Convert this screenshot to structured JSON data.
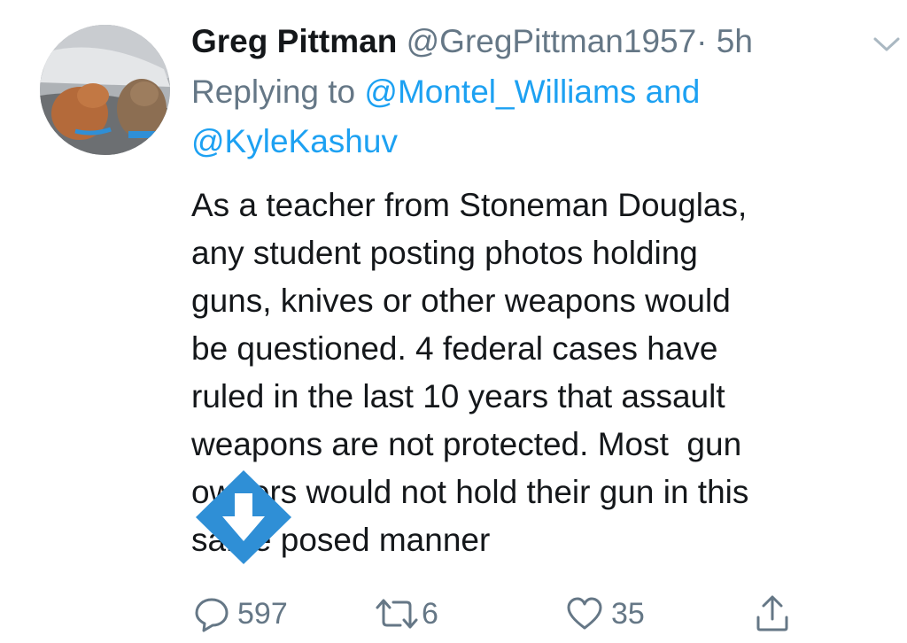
{
  "tweet": {
    "author_name": "Greg Pittman",
    "author_handle": "@GregPittman1957",
    "separator": "·",
    "time": "5h",
    "reply_prefix": "Replying to",
    "reply_user_1": "@Montel_Williams",
    "reply_and": "and",
    "reply_user_2": "@KyleKashuv",
    "body_lines": [
      "As a teacher from Stoneman Douglas,",
      "any student posting photos holding",
      "guns, knives or other weapons would",
      "be questioned. 4 federal cases have",
      "ruled in the last 10 years that assault",
      "weapons are not protected. Most  gun",
      "owners would not hold their gun in this",
      "same posed manner"
    ],
    "reply_count": "597",
    "retweet_count": "6",
    "like_count": "35"
  },
  "icons": {
    "caret": "chevron-down-icon",
    "reply": "comment-icon",
    "retweet": "retweet-icon",
    "like": "heart-icon",
    "share": "share-icon",
    "watermark": "download-arrow-icon"
  },
  "colors": {
    "link": "#1da1f2",
    "secondary_text": "#657786",
    "primary_text": "#14171a",
    "watermark": "#2f8fd6"
  }
}
